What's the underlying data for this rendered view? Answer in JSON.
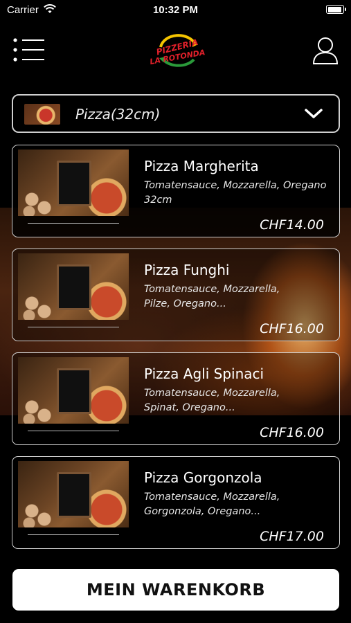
{
  "status_bar": {
    "carrier": "Carrier",
    "time": "10:32 PM"
  },
  "header": {
    "logo_text_top": "PIZZERIA",
    "logo_text_bottom": "LA ROTONDA",
    "menu_icon": "list-menu-icon",
    "user_icon": "user-icon"
  },
  "category": {
    "selected": "Pizza(32cm)"
  },
  "items": [
    {
      "name": "Pizza Margherita",
      "description": "Tomatensauce, Mozzarella, Oregano 32cm",
      "price": "CHF14.00"
    },
    {
      "name": "Pizza Funghi",
      "description": "Tomatensauce, Mozzarella, Pilze, Oregano...",
      "price": "CHF16.00"
    },
    {
      "name": "Pizza Agli Spinaci",
      "description": "Tomatensauce, Mozzarella, Spinat, Oregano...",
      "price": "CHF16.00"
    },
    {
      "name": "Pizza Gorgonzola",
      "description": "Tomatensauce, Mozzarella, Gorgonzola, Oregano...",
      "price": "CHF17.00"
    }
  ],
  "cart_button": {
    "label": "MEIN WARENKORB"
  },
  "colors": {
    "background": "#000000",
    "accent": "#ffffff",
    "logo_red": "#e0202a",
    "logo_yellow": "#f5c400",
    "logo_green": "#2a9a3a"
  }
}
